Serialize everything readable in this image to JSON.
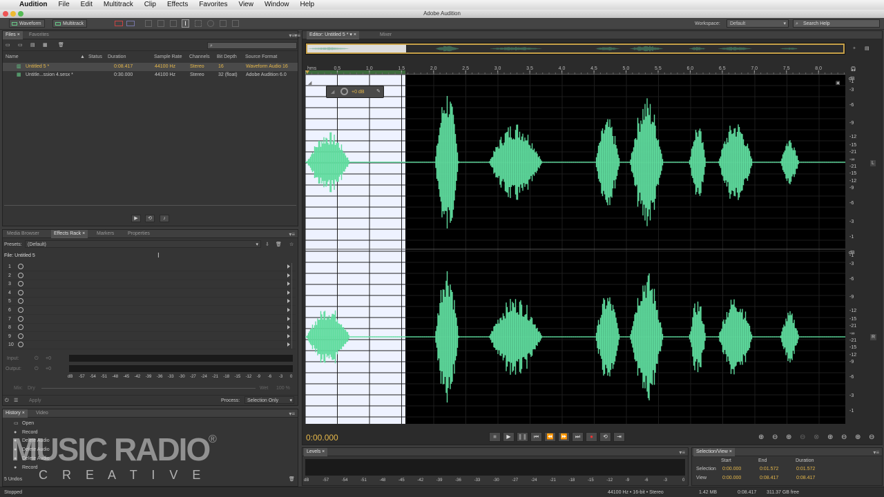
{
  "menu": {
    "apple": "",
    "app": "Audition",
    "items": [
      "File",
      "Edit",
      "Multitrack",
      "Clip",
      "Effects",
      "Favorites",
      "View",
      "Window",
      "Help"
    ]
  },
  "window_title": "Adobe Audition",
  "toolbar": {
    "waveform": "Waveform",
    "multitrack": "Multitrack",
    "workspace_label": "Workspace:",
    "workspace_value": "Default",
    "search_placeholder": "Search Help"
  },
  "files": {
    "tabs": [
      "Files",
      "Favorites"
    ],
    "columns": [
      "Name",
      "Status",
      "Duration",
      "Sample Rate",
      "Channels",
      "Bit Depth",
      "Source Format"
    ],
    "rows": [
      {
        "name": "Untitled 5 *",
        "status": "",
        "duration": "0:08.417",
        "rate": "44100 Hz",
        "channels": "Stereo",
        "depth": "16",
        "format": "Waveform Audio 16"
      },
      {
        "name": "Untitle...ssion 4.sesx *",
        "status": "",
        "duration": "0:30.000",
        "rate": "44100 Hz",
        "channels": "Stereo",
        "depth": "32 (float)",
        "format": "Adobe Audition 6.0"
      }
    ]
  },
  "effects": {
    "tabs": [
      "Media Browser",
      "Effects Rack",
      "Markers",
      "Properties"
    ],
    "presets_label": "Presets:",
    "presets_value": "(Default)",
    "file_label": "File: Untitled 5",
    "slots": [
      "1",
      "2",
      "3",
      "4",
      "5",
      "6",
      "7",
      "8",
      "9",
      "10"
    ],
    "input": "Input:",
    "output": "Output:",
    "zero": "+0",
    "scale": [
      "dB",
      "-57",
      "-54",
      "-51",
      "-48",
      "-45",
      "-42",
      "-39",
      "-36",
      "-33",
      "-30",
      "-27",
      "-24",
      "-21",
      "-18",
      "-15",
      "-12",
      "-9",
      "-6",
      "-3",
      "0"
    ],
    "mix": "Mix:",
    "dry": "Dry",
    "wet": "Wet",
    "pct": "100 %",
    "apply": "Apply",
    "process_label": "Process:",
    "process_value": "Selection Only"
  },
  "history": {
    "tabs": [
      "History",
      "Video"
    ],
    "items": [
      "Open",
      "Record",
      "Delete Audio",
      "Delete Audio",
      "Delete Audio",
      "Record"
    ],
    "undo": "5 Undos",
    "status": "Stopped"
  },
  "watermark": {
    "brand": "MUSIC RADIO",
    "sub": "C R E A T I V E",
    "reg": "®"
  },
  "editor": {
    "tabs": [
      "Editor: Untitled 5 *",
      "Mixer"
    ],
    "ruler": [
      "hms",
      "0.5",
      "1.0",
      "1.5",
      "2.0",
      "2.5",
      "3.0",
      "3.5",
      "4.0",
      "4.5",
      "5.0",
      "5.5",
      "6.0",
      "6.5",
      "7.0",
      "7.5",
      "8.0"
    ],
    "hud_gain": "+0 dB",
    "db_scale": [
      "dB",
      "-1",
      "-3",
      "-6",
      "-9",
      "-12",
      "-15",
      "-21",
      "-∞",
      "-21",
      "-15",
      "-12",
      "-9",
      "-6",
      "-3",
      "-1"
    ],
    "ch_left": "L",
    "ch_right": "R",
    "time": "0:00.000",
    "wave_color": "#5fdc9e",
    "selection_color": "#eef2ff"
  },
  "levels": {
    "title": "Levels",
    "scale": [
      "dB",
      "-57",
      "-54",
      "-51",
      "-48",
      "-45",
      "-42",
      "-39",
      "-36",
      "-33",
      "-30",
      "-27",
      "-24",
      "-21",
      "-18",
      "-15",
      "-12",
      "-9",
      "-6",
      "-3",
      "0"
    ]
  },
  "selview": {
    "title": "Selection/View",
    "cols": [
      "Start",
      "End",
      "Duration"
    ],
    "selection": {
      "label": "Selection",
      "start": "0:00.000",
      "end": "0:01.572",
      "duration": "0:01.572"
    },
    "view": {
      "label": "View",
      "start": "0:00.000",
      "end": "0:08.417",
      "duration": "0:08.417"
    }
  },
  "status": {
    "format": "44100 Hz • 16-bit • Stereo",
    "size": "1.42 MB",
    "duration": "0:08.417",
    "free": "311.37 GB free"
  }
}
